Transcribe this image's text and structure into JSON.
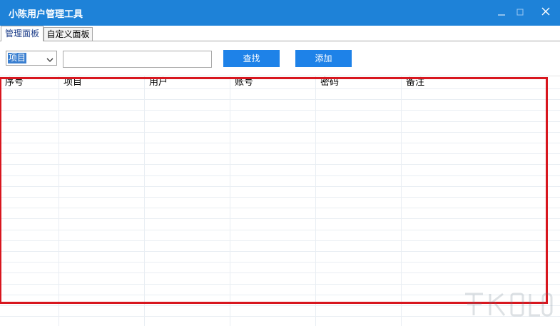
{
  "window": {
    "title": "小陈用户管理工具",
    "controls": {
      "minimize": "–",
      "maximize": "□",
      "close": "✕"
    }
  },
  "tabs": [
    {
      "label": "管理面板",
      "active": true
    },
    {
      "label": "自定义面板",
      "active": false
    }
  ],
  "toolbar": {
    "field_select": {
      "value": "项目",
      "arrow": "⌄"
    },
    "search_input": {
      "value": "",
      "placeholder": ""
    },
    "search_button": "查找",
    "add_button": "添加"
  },
  "grid": {
    "columns": [
      "序号",
      "项目",
      "用户",
      "账号",
      "密码",
      "备注"
    ],
    "rows": []
  },
  "colors": {
    "title_bar": "#1e82d8",
    "button": "#1e82e8",
    "highlight": "#d8161e"
  }
}
